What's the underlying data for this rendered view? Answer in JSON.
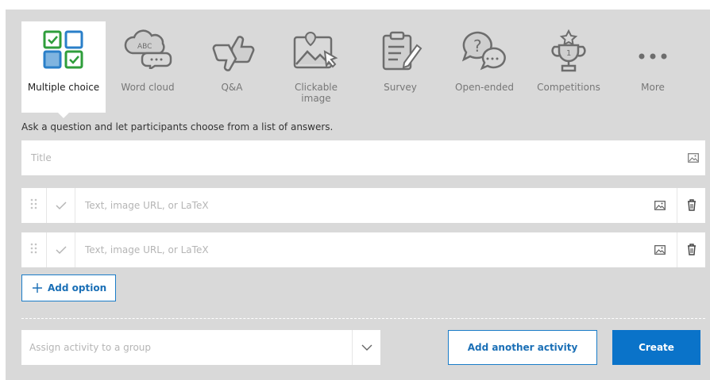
{
  "tabs": [
    {
      "label": "Multiple choice",
      "icon": "multiple-choice-icon",
      "active": true
    },
    {
      "label": "Word cloud",
      "icon": "word-cloud-icon",
      "active": false
    },
    {
      "label": "Q&A",
      "icon": "thumbs-icon",
      "active": false
    },
    {
      "label": "Clickable image",
      "icon": "clickable-image-icon",
      "active": false
    },
    {
      "label": "Survey",
      "icon": "survey-icon",
      "active": false
    },
    {
      "label": "Open-ended",
      "icon": "open-ended-icon",
      "active": false
    },
    {
      "label": "Competitions",
      "icon": "trophy-icon",
      "active": false
    },
    {
      "label": "More",
      "icon": "more-icon",
      "active": false
    }
  ],
  "hint": "Ask a question and let participants choose from a list of answers.",
  "title": {
    "placeholder": "Title"
  },
  "options": [
    {
      "placeholder": "Text, image URL, or LaTeX"
    },
    {
      "placeholder": "Text, image URL, or LaTeX"
    }
  ],
  "add_option_label": "Add option",
  "group": {
    "placeholder": "Assign activity to a group"
  },
  "add_activity_label": "Add another activity",
  "create_label": "Create",
  "colors": {
    "accent": "#0a73c9",
    "green": "#2f9e3b",
    "blue": "#2a7fc9"
  }
}
